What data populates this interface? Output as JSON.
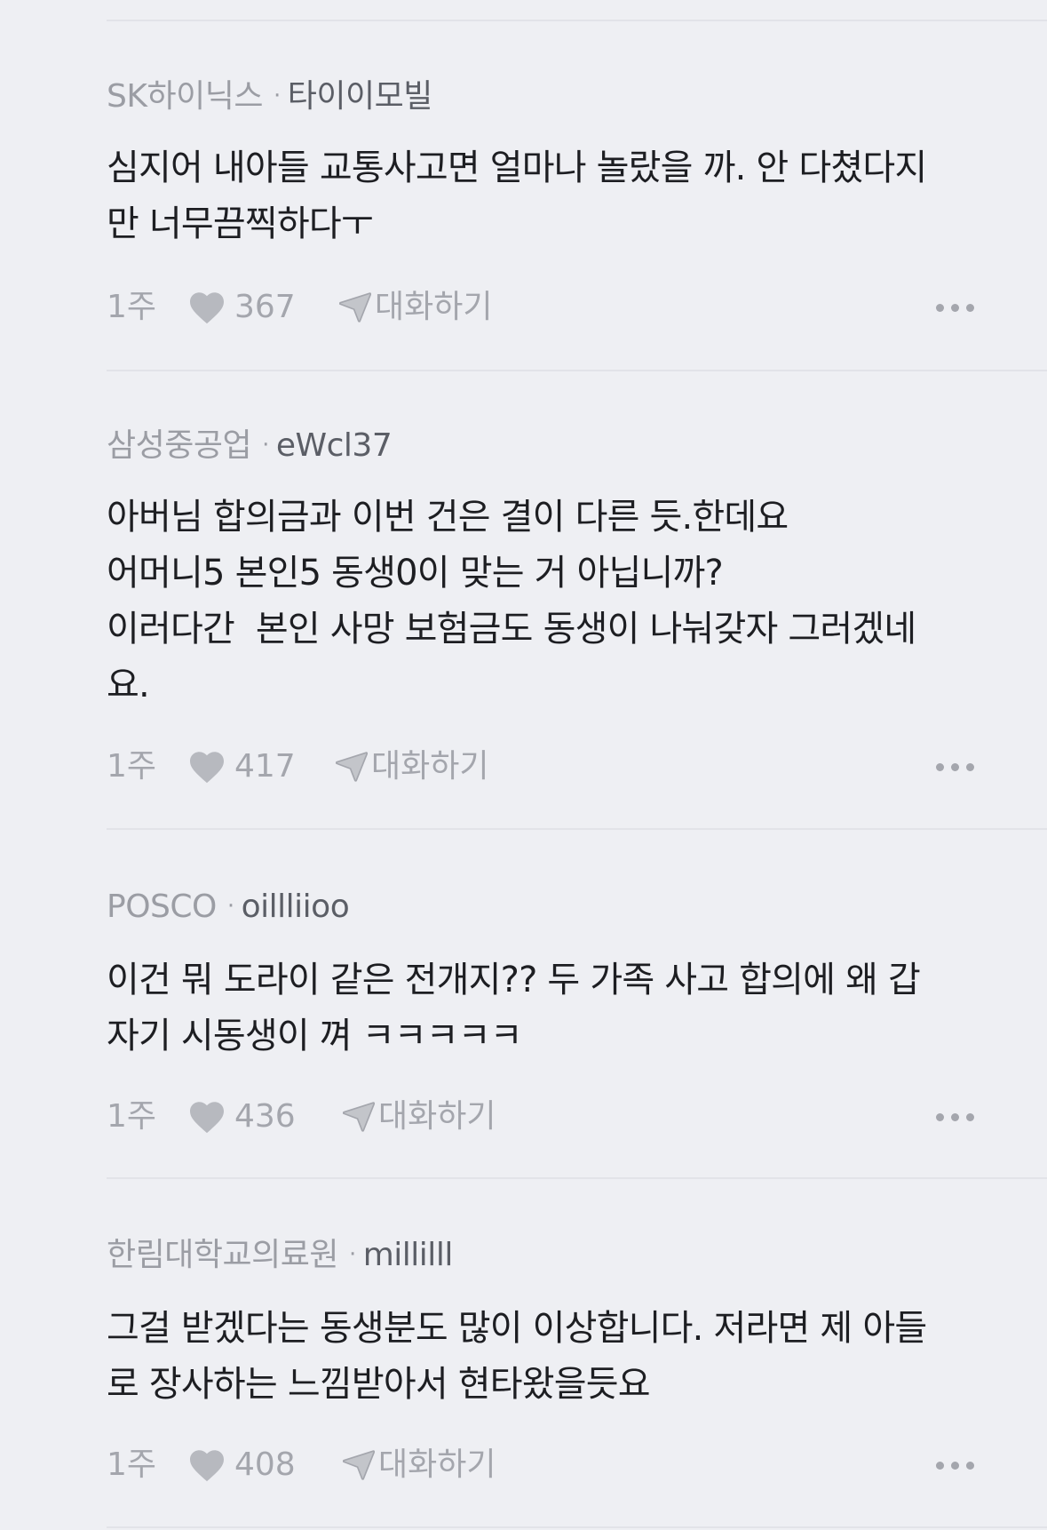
{
  "comments": [
    {
      "company": "SK하이닉스",
      "separator": "·",
      "nickname": "타이이모빌",
      "body": "심지어 내아들 교통사고면 얼마나 놀랐을 까. 안 다쳤다지\n만 너무끔찍하다ㅜ",
      "time": "1주",
      "likes": "367",
      "reply_label": "대화하기"
    },
    {
      "company": "삼성중공업",
      "separator": "·",
      "nickname": "eWcl37",
      "body": "아버님 합의금과 이번 건은 결이 다른 듯.한데요\n어머니5 본인5 동생0이 맞는 거 아닙니까?\n이러다간  본인 사망 보험금도 동생이 나눠갖자 그러겠네\n요.",
      "time": "1주",
      "likes": "417",
      "reply_label": "대화하기"
    },
    {
      "company": "POSCO",
      "separator": "·",
      "nickname": "oillliioo",
      "body": "이건 뭐 도라이 같은 전개지?? 두 가족 사고 합의에 왜 갑\n자기 시동생이 껴 ㅋㅋㅋㅋㅋ",
      "time": "1주",
      "likes": "436",
      "reply_label": "대화하기"
    },
    {
      "company": "한림대학교의료원",
      "separator": "·",
      "nickname": "millilll",
      "body": "그걸 받겠다는 동생분도 많이 이상합니다. 저라면 제 아들\n로 장사하는 느낌받아서 현타왔을듯요",
      "time": "1주",
      "likes": "408",
      "reply_label": "대화하기"
    }
  ],
  "icons": {
    "like": "heart-icon",
    "reply": "paper-plane-icon",
    "more": "more-dots-icon"
  },
  "colors": {
    "background": "#eeeff3",
    "divider": "#e2e3e8",
    "meta_gray": "#9b9da4",
    "icon_gray": "#a4a6ad",
    "text": "#1d1e22"
  }
}
